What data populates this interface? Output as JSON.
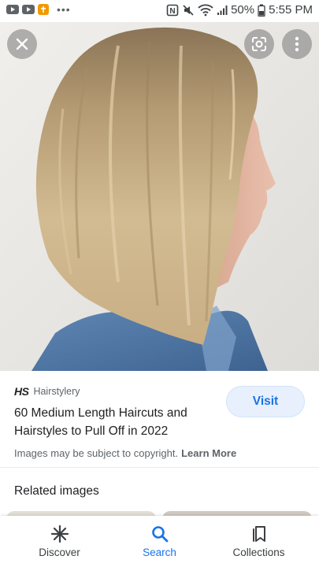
{
  "status_bar": {
    "battery": "50%",
    "time": "5:55 PM",
    "left_icons": [
      "youtube-icon",
      "youtube-icon",
      "church-app-icon",
      "more-notifications-icon"
    ],
    "right_icons": [
      "nfc-icon",
      "mute-icon",
      "wifi-icon",
      "signal-icon",
      "battery-icon"
    ]
  },
  "viewer": {
    "close_icon": "close-icon",
    "lens_icon": "google-lens-icon",
    "menu_icon": "more-vert-icon"
  },
  "result": {
    "source_logo": "HS",
    "source_name": "Hairstylery",
    "visit_label": "Visit",
    "title": "60 Medium Length Haircuts and Hairstyles to Pull Off in 2022",
    "copyright_text": "Images may be subject to copyright.",
    "learn_more": "Learn More"
  },
  "related": {
    "heading": "Related images"
  },
  "bottom_nav": {
    "items": [
      {
        "label": "Discover",
        "icon": "discover-asterisk-icon",
        "active": false
      },
      {
        "label": "Search",
        "icon": "search-icon",
        "active": true
      },
      {
        "label": "Collections",
        "icon": "collections-bookmark-icon",
        "active": false
      }
    ]
  },
  "colors": {
    "accent": "#1a73e8",
    "visit_bg": "#e8f0fe",
    "text_primary": "#202124",
    "text_secondary": "#5f6368"
  }
}
